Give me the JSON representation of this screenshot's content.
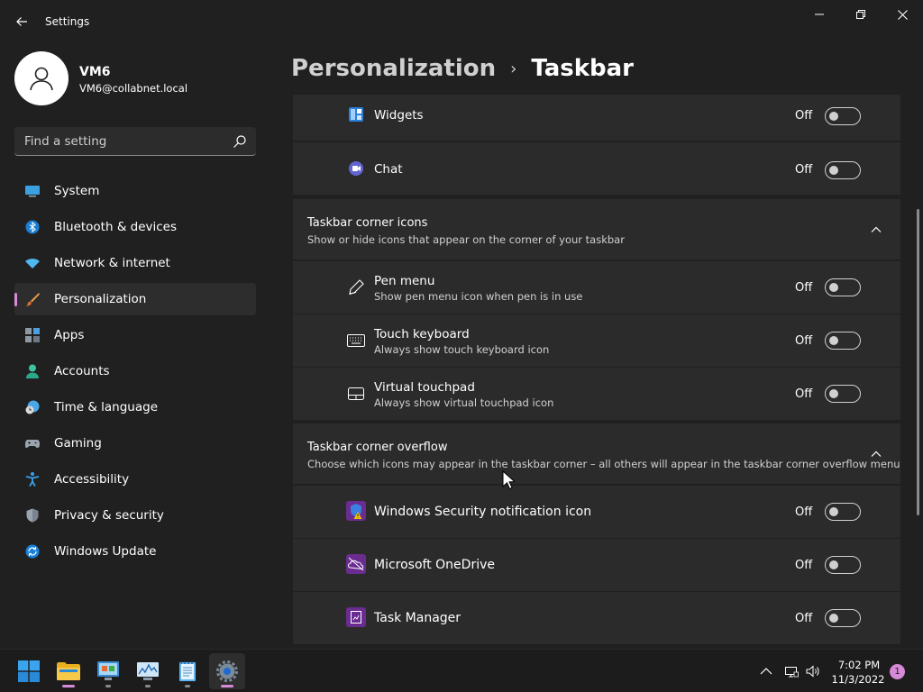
{
  "window": {
    "title": "Settings"
  },
  "profile": {
    "name": "VM6",
    "email": "VM6@collabnet.local"
  },
  "search": {
    "placeholder": "Find a setting"
  },
  "nav": {
    "items": [
      {
        "label": "System",
        "icon": "system-icon"
      },
      {
        "label": "Bluetooth & devices",
        "icon": "bluetooth-icon"
      },
      {
        "label": "Network & internet",
        "icon": "wifi-icon"
      },
      {
        "label": "Personalization",
        "icon": "brush-icon",
        "selected": true
      },
      {
        "label": "Apps",
        "icon": "apps-icon"
      },
      {
        "label": "Accounts",
        "icon": "person-icon"
      },
      {
        "label": "Time & language",
        "icon": "clock-globe-icon"
      },
      {
        "label": "Gaming",
        "icon": "gamepad-icon"
      },
      {
        "label": "Accessibility",
        "icon": "accessibility-icon"
      },
      {
        "label": "Privacy & security",
        "icon": "shield-icon"
      },
      {
        "label": "Windows Update",
        "icon": "update-icon"
      }
    ]
  },
  "breadcrumb": {
    "parent": "Personalization",
    "separator": "›",
    "current": "Taskbar"
  },
  "taskbar_items": [
    {
      "title": "Widgets",
      "state": "Off",
      "icon": "widgets-icon"
    },
    {
      "title": "Chat",
      "state": "Off",
      "icon": "chat-icon"
    }
  ],
  "corner_icons": {
    "title": "Taskbar corner icons",
    "description": "Show or hide icons that appear on the corner of your taskbar",
    "items": [
      {
        "title": "Pen menu",
        "description": "Show pen menu icon when pen is in use",
        "state": "Off",
        "icon": "pen-icon"
      },
      {
        "title": "Touch keyboard",
        "description": "Always show touch keyboard icon",
        "state": "Off",
        "icon": "keyboard-icon"
      },
      {
        "title": "Virtual touchpad",
        "description": "Always show virtual touchpad icon",
        "state": "Off",
        "icon": "touchpad-icon"
      }
    ]
  },
  "corner_overflow": {
    "title": "Taskbar corner overflow",
    "description": "Choose which icons may appear in the taskbar corner – all others will appear in the taskbar corner overflow menu",
    "items": [
      {
        "title": "Windows Security notification icon",
        "state": "Off",
        "icon": "windows-security-icon"
      },
      {
        "title": "Microsoft OneDrive",
        "state": "Off",
        "icon": "onedrive-icon"
      },
      {
        "title": "Task Manager",
        "state": "Off",
        "icon": "task-manager-icon"
      }
    ]
  },
  "system_tray": {
    "time": "7:02 PM",
    "date": "11/3/2022",
    "notification_count": "1"
  },
  "colors": {
    "accent": "#d689d6",
    "background": "#202020",
    "card": "#2b2b2b"
  }
}
